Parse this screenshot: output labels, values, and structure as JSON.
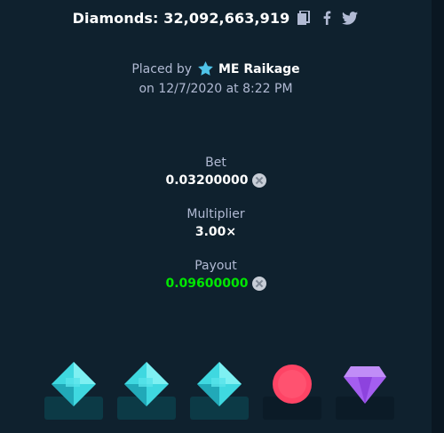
{
  "header": {
    "title": "Diamonds: 32,092,663,919"
  },
  "placed": {
    "prefix": "Placed by",
    "user": "ME Raikage",
    "date_line": "on 12/7/2020 at 8:22 PM"
  },
  "stats": {
    "bet_label": "Bet",
    "bet_value": "0.03200000",
    "multiplier_label": "Multiplier",
    "multiplier_value": "3.00×",
    "payout_label": "Payout",
    "payout_value": "0.09600000"
  },
  "tiles": [
    {
      "type": "diamond",
      "revealed": true
    },
    {
      "type": "diamond",
      "revealed": true
    },
    {
      "type": "diamond",
      "revealed": true
    },
    {
      "type": "red-circle",
      "revealed": false
    },
    {
      "type": "purple-gem",
      "revealed": false
    }
  ],
  "colors": {
    "background": "#0f212e",
    "label": "#b1bad3",
    "payout": "#00e701",
    "diamond": "#3fd8e0",
    "red": "#fe4465",
    "purple": "#a45ef0"
  },
  "icons": {
    "copy": "copy-icon",
    "facebook": "facebook-icon",
    "twitter": "twitter-icon",
    "star": "star-icon",
    "coin": "coin-icon"
  }
}
